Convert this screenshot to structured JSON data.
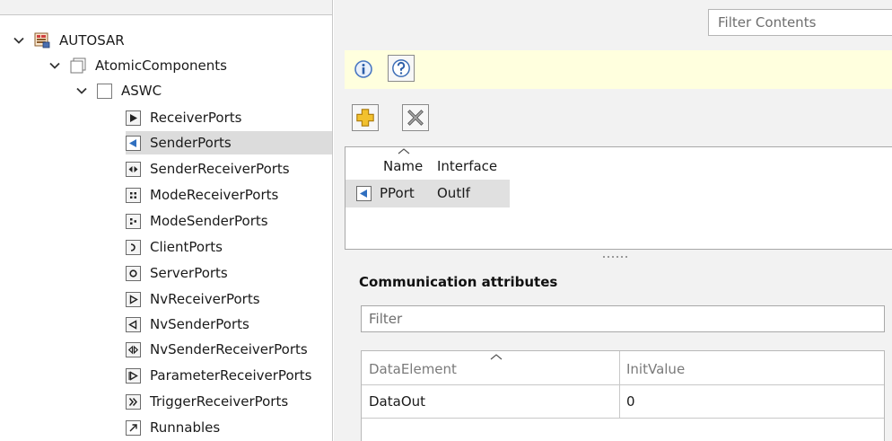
{
  "tree": {
    "root": {
      "label": "AUTOSAR",
      "icon": "autosar-package-icon"
    },
    "atomic": {
      "label": "AtomicComponents",
      "icon": "folder-icon"
    },
    "aswc": {
      "label": "ASWC",
      "icon": "component-icon"
    },
    "items": [
      {
        "label": "ReceiverPorts",
        "icon": "receiver-port-icon"
      },
      {
        "label": "SenderPorts",
        "icon": "sender-port-icon",
        "selected": true
      },
      {
        "label": "SenderReceiverPorts",
        "icon": "sender-receiver-port-icon"
      },
      {
        "label": "ModeReceiverPorts",
        "icon": "mode-receiver-port-icon"
      },
      {
        "label": "ModeSenderPorts",
        "icon": "mode-sender-port-icon"
      },
      {
        "label": "ClientPorts",
        "icon": "client-port-icon"
      },
      {
        "label": "ServerPorts",
        "icon": "server-port-icon"
      },
      {
        "label": "NvReceiverPorts",
        "icon": "nv-receiver-port-icon"
      },
      {
        "label": "NvSenderPorts",
        "icon": "nv-sender-port-icon"
      },
      {
        "label": "NvSenderReceiverPorts",
        "icon": "nv-sender-receiver-port-icon"
      },
      {
        "label": "ParameterReceiverPorts",
        "icon": "parameter-receiver-port-icon"
      },
      {
        "label": "TriggerReceiverPorts",
        "icon": "trigger-receiver-port-icon"
      },
      {
        "label": "Runnables",
        "icon": "runnable-icon"
      }
    ]
  },
  "header": {
    "filter_placeholder": "Filter Contents"
  },
  "info_bar": {
    "info_icon": "info-icon",
    "help_icon": "help-icon"
  },
  "toolbar": {
    "add_icon": "add-icon",
    "delete_icon": "delete-icon"
  },
  "ports_table": {
    "columns": [
      "Name",
      "Interface"
    ],
    "rows": [
      {
        "name": "PPort",
        "interface": "OutIf",
        "icon": "sender-port-icon"
      }
    ]
  },
  "comm": {
    "title": "Communication attributes",
    "filter_placeholder": "Filter",
    "columns": [
      "DataElement",
      "InitValue"
    ],
    "rows": [
      {
        "data_element": "DataOut",
        "init_value": "0"
      }
    ]
  },
  "colors": {
    "info_strip": "#ffffde",
    "selection": "#dcdcdc",
    "panel_bg": "#f2f2f2",
    "port_blue": "#2f6fc0",
    "add_yellow": "#f2c12e"
  }
}
